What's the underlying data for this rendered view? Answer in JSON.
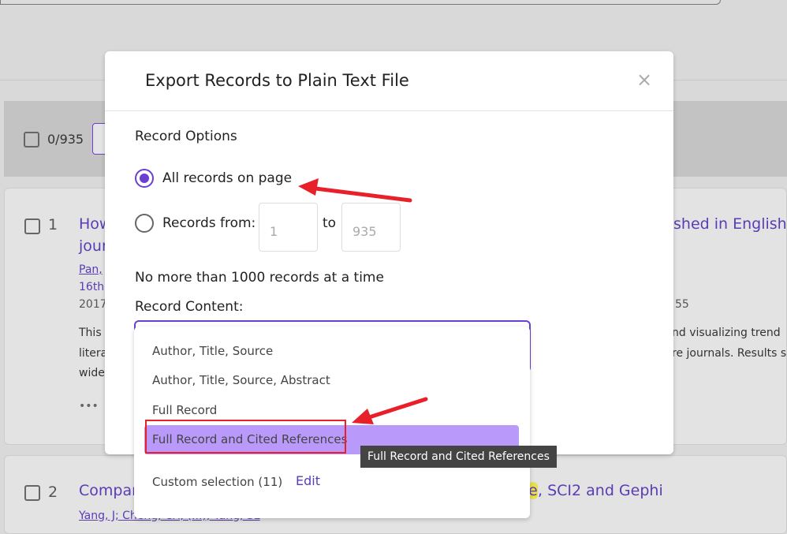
{
  "toolbar": {
    "selected_count": "0/935"
  },
  "results": [
    {
      "number": "1",
      "title_left": "How",
      "title_left2": "jour",
      "title_right": "shed in English",
      "authors": "Pan,",
      "meta": "16th",
      "year": "2017",
      "year_right": "55",
      "abstract_left": [
        "This",
        "litera",
        "wide"
      ],
      "abstract_right": [
        "nd visualizing trend",
        "re journals. Results s"
      ],
      "more": "•••"
    },
    {
      "number": "2",
      "title_left": "Compar",
      "title_right_highlight": "e",
      "title_right": ", SCI2 and Gephi",
      "authors": "Yang, J; Cheng, CX; (...); Yang, SL"
    }
  ],
  "modal": {
    "title": "Export Records to Plain Text File",
    "close": "×",
    "record_options_label": "Record Options",
    "option_all": "All records on page",
    "option_range": "Records from:",
    "range_from": "1",
    "range_to_label": "to",
    "range_to": "935",
    "limit_note": "No more than 1000 records at a time",
    "record_content_label": "Record Content:",
    "dropdown": {
      "options": [
        "Author, Title, Source",
        "Author, Title, Source, Abstract",
        "Full Record",
        "Full Record and Cited References"
      ],
      "highlighted": "Full Record and Cited References",
      "custom": "Custom selection (11)",
      "edit": "Edit"
    },
    "tooltip": "Full Record and Cited References"
  },
  "colors": {
    "accent": "#6a3fd1",
    "highlight": "#b99afa",
    "annotation": "#e8202a"
  }
}
